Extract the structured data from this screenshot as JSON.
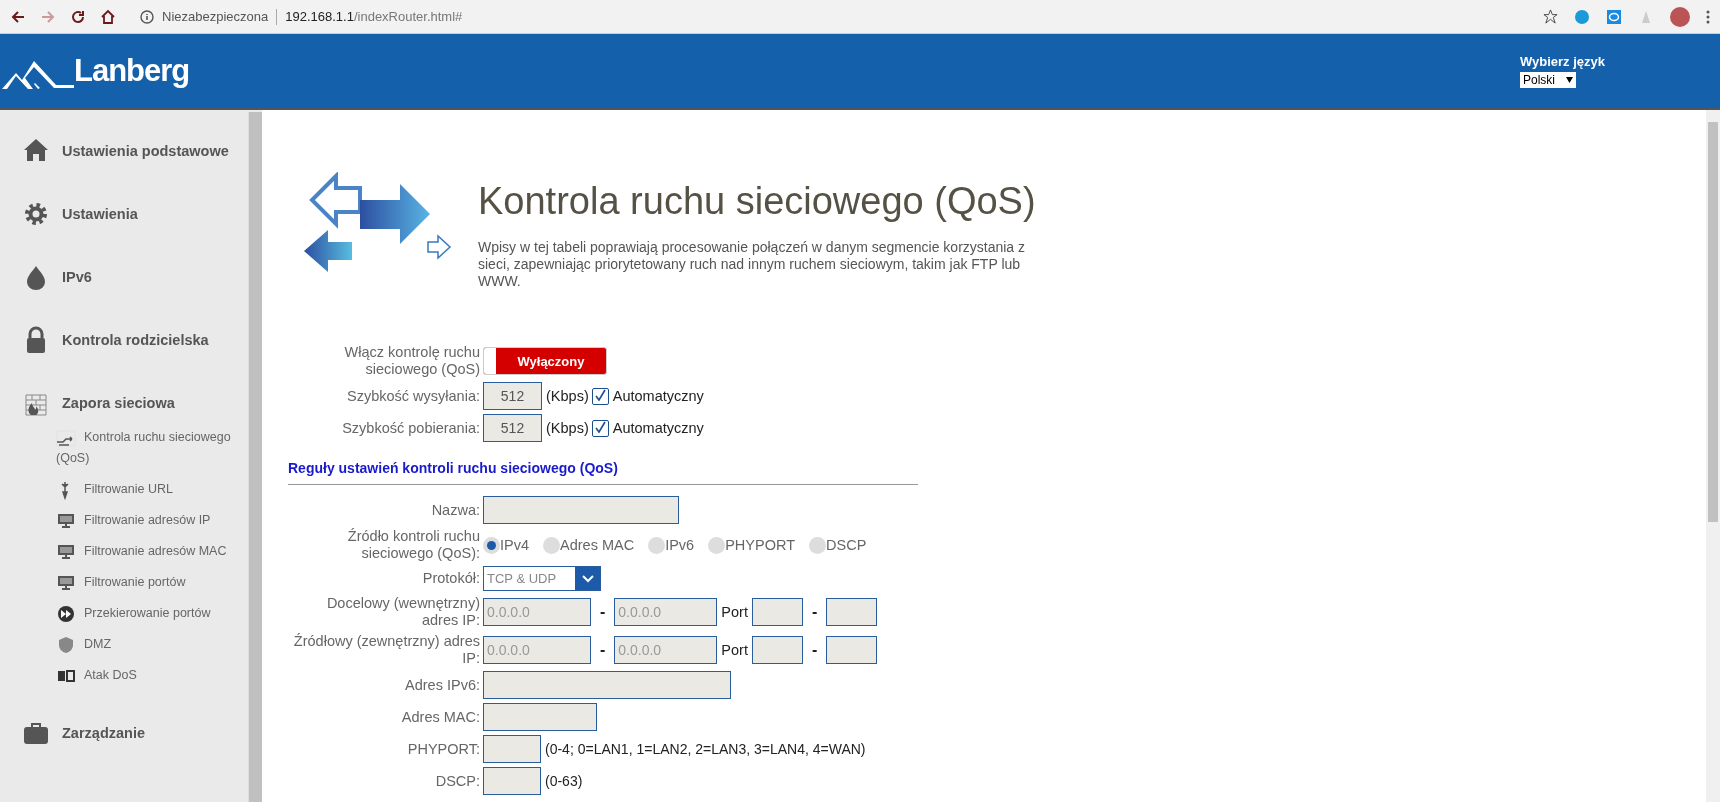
{
  "browser": {
    "security_label": "Niezabezpieczona",
    "url_host": "192.168.1.1",
    "url_path": "/indexRouter.html#"
  },
  "header": {
    "logo": "Lanberg",
    "language": {
      "label": "Wybierz język",
      "value": "Polski"
    }
  },
  "sidebar": {
    "items": [
      {
        "label": "Ustawienia podstawowe"
      },
      {
        "label": "Ustawienia"
      },
      {
        "label": "IPv6"
      },
      {
        "label": "Kontrola rodzicielska"
      },
      {
        "label": "Zapora sieciowa",
        "children": [
          {
            "label": "Kontrola ruchu sieciowego (QoS)"
          },
          {
            "label": "Filtrowanie URL"
          },
          {
            "label": "Filtrowanie adresów IP"
          },
          {
            "label": "Filtrowanie adresów MAC"
          },
          {
            "label": "Filtrowanie portów"
          },
          {
            "label": "Przekierowanie portów"
          },
          {
            "label": "DMZ"
          },
          {
            "label": "Atak DoS"
          }
        ]
      },
      {
        "label": "Zarządzanie"
      }
    ]
  },
  "page": {
    "title": "Kontrola ruchu sieciowego (QoS)",
    "description": "Wpisy w tej tabeli poprawiają procesowanie połączeń w danym segmencie korzystania z sieci, zapewniając priorytetowany ruch nad innym ruchem sieciowym, takim jak FTP lub WWW."
  },
  "qos": {
    "toggle": {
      "label": "Włącz kontrolę ruchu sieciowego (QoS)",
      "state_text": "Wyłączony",
      "on": false
    },
    "speeds": [
      {
        "label": "Szybkość wysyłania:",
        "value": "512",
        "unit": "(Kbps)",
        "auto_label": "Automatyczny",
        "auto_checked": true
      },
      {
        "label": "Szybkość pobierania:",
        "value": "512",
        "unit": "(Kbps)",
        "auto_label": "Automatyczny",
        "auto_checked": true
      }
    ]
  },
  "rules": {
    "heading": "Reguły ustawień kontroli ruchu sieciowego (QoS)",
    "rows": [
      {
        "kind": "text",
        "label": "Nazwa:"
      },
      {
        "kind": "radio",
        "label": "Źródło kontroli ruchu sieciowego (QoS):",
        "options": [
          {
            "label": "IPv4",
            "selected": true
          },
          {
            "label": "Adres MAC",
            "selected": false
          },
          {
            "label": "IPv6",
            "selected": false
          },
          {
            "label": "PHYPORT",
            "selected": false
          },
          {
            "label": "DSCP",
            "selected": false
          }
        ]
      },
      {
        "kind": "select",
        "label": "Protokół:",
        "value": "TCP & UDP"
      },
      {
        "kind": "range",
        "label": "Docelowy (wewnętrzny) adres IP:",
        "from_placeholder": "0.0.0.0",
        "separator": "-",
        "to_placeholder": "0.0.0.0",
        "port_label": "Port",
        "port_separator": "-"
      },
      {
        "kind": "range",
        "label": "Źródłowy (zewnętrzny) adres IP:",
        "from_placeholder": "0.0.0.0",
        "separator": "-",
        "to_placeholder": "0.0.0.0",
        "port_label": "Port",
        "port_separator": "-"
      },
      {
        "kind": "wide",
        "label": "Adres IPv6:"
      },
      {
        "kind": "medium",
        "label": "Adres MAC:"
      },
      {
        "kind": "short",
        "label": "PHYPORT:",
        "note": "(0-4; 0=LAN1, 1=LAN2, 2=LAN3, 3=LAN4, 4=WAN)"
      },
      {
        "kind": "short",
        "label": "DSCP:",
        "note": "(0-63)"
      }
    ]
  }
}
